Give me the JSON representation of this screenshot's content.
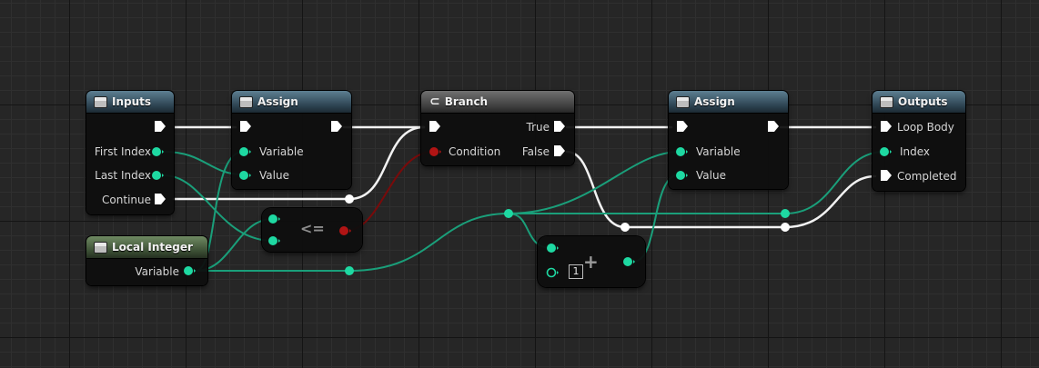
{
  "nodes": {
    "inputs": {
      "title": "Inputs",
      "pins": {
        "first_index": "First Index",
        "last_index": "Last Index",
        "continue": "Continue"
      }
    },
    "local_integer": {
      "title": "Local Integer",
      "pins": {
        "variable": "Variable"
      }
    },
    "assign_1": {
      "title": "Assign",
      "pins": {
        "variable": "Variable",
        "value": "Value"
      }
    },
    "compare": {
      "op": "<="
    },
    "branch": {
      "title": "Branch",
      "pins": {
        "condition": "Condition",
        "true": "True",
        "false": "False"
      }
    },
    "assign_2": {
      "title": "Assign",
      "pins": {
        "variable": "Variable",
        "value": "Value"
      }
    },
    "increment": {
      "op": "+",
      "constant": "1"
    },
    "outputs": {
      "title": "Outputs",
      "pins": {
        "loop_body": "Loop Body",
        "index": "Index",
        "completed": "Completed"
      }
    }
  },
  "colors": {
    "grid_background": "#262626",
    "exec_wire": "#ffffff",
    "integer_pin": "#1ed9a2",
    "integer_wire": "#1a9f7a",
    "bool_pin": "#b11414",
    "bool_wire": "#7a0a0a",
    "function_header": "#2c4250",
    "variable_header": "#3a4d33",
    "flow_header": "#3f3f3f"
  },
  "icons": {
    "node_header": "function-icon",
    "branch_header": "branch-icon",
    "exec_pin": "exec-arrow-icon",
    "data_pin": "data-pin-icon"
  }
}
